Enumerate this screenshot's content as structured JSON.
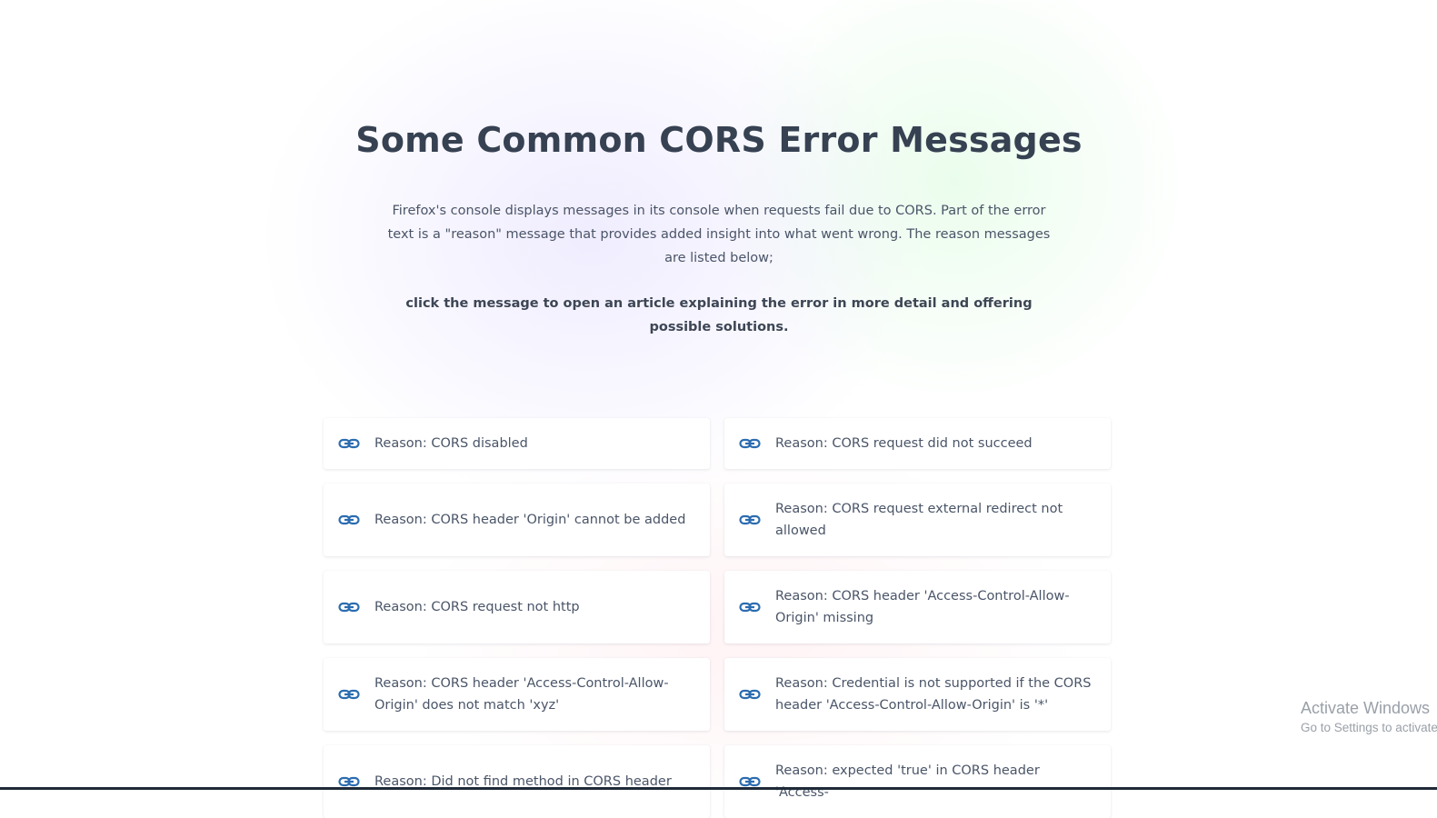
{
  "page": {
    "title": "Some Common CORS Error Messages",
    "intro": "Firefox's console displays messages in its console when requests fail due to CORS. Part of the error text is a \"reason\" message that provides added insight into what went wrong. The reason messages are listed below;",
    "hint": "click the message to open an article explaining the error in more detail and offering possible solutions."
  },
  "reasons": [
    {
      "label": "Reason: CORS disabled",
      "icon": "link-icon"
    },
    {
      "label": "Reason: CORS request did not succeed",
      "icon": "link-icon"
    },
    {
      "label": "Reason: CORS header 'Origin' cannot be added",
      "icon": "link-icon"
    },
    {
      "label": "Reason: CORS request external redirect not allowed",
      "icon": "link-icon"
    },
    {
      "label": "Reason: CORS request not http",
      "icon": "link-icon"
    },
    {
      "label": "Reason: CORS header 'Access-Control-Allow-Origin' missing",
      "icon": "link-icon"
    },
    {
      "label": "Reason: CORS header 'Access-Control-Allow-Origin' does not match 'xyz'",
      "icon": "link-icon"
    },
    {
      "label": "Reason: Credential is not supported if the CORS header 'Access-Control-Allow-Origin' is '*'",
      "icon": "link-icon"
    },
    {
      "label": "Reason: Did not find method in CORS header",
      "icon": "link-icon"
    },
    {
      "label": "Reason: expected 'true' in CORS header 'Access-",
      "icon": "link-icon"
    }
  ],
  "overlay": {
    "activate_title": "Activate Windows",
    "activate_sub": "Go to Settings to activate Windows."
  },
  "colors": {
    "accent": "#2b6cb0",
    "title": "#364152",
    "text": "#4a5568"
  }
}
